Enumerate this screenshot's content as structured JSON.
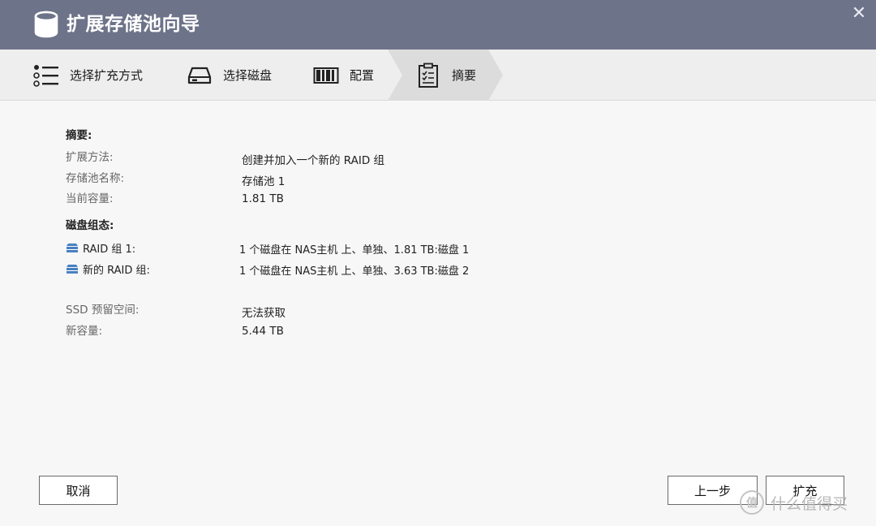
{
  "window": {
    "title": "扩展存储池向导",
    "close_symbol": "✕"
  },
  "steps": [
    {
      "label": "选择扩充方式",
      "icon": "list-icon",
      "active": false
    },
    {
      "label": "选择磁盘",
      "icon": "disk-drive-icon",
      "active": false
    },
    {
      "label": "配置",
      "icon": "raid-config-icon",
      "active": false
    },
    {
      "label": "摘要",
      "icon": "clipboard-checklist-icon",
      "active": true
    }
  ],
  "summary": {
    "heading": "摘要:",
    "items": [
      {
        "label": "扩展方法:",
        "value": "创建并加入一个新的 RAID 组"
      },
      {
        "label": "存储池名称:",
        "value": "存储池 1"
      },
      {
        "label": "当前容量:",
        "value": "1.81 TB"
      }
    ]
  },
  "disk_config": {
    "heading": "磁盘组态:",
    "groups": [
      {
        "label": "RAID 组 1:",
        "value": "1 个磁盘在 NAS主机 上、单独、1.81 TB:磁盘 1"
      },
      {
        "label": "新的 RAID 组:",
        "value": "1 个磁盘在 NAS主机 上、单独、3.63 TB:磁盘 2"
      }
    ]
  },
  "extra": {
    "items": [
      {
        "label": "SSD 预留空间:",
        "value": "无法获取"
      },
      {
        "label": "新容量:",
        "value": "5.44 TB"
      }
    ]
  },
  "buttons": {
    "cancel": "取消",
    "back": "上一步",
    "expand": "扩充"
  },
  "watermark": {
    "badge": "值",
    "text": "什么值得买"
  },
  "colors": {
    "titlebar": "#6d7389",
    "stepbar": "#eeeeee",
    "active_step": "#dcdcdc",
    "disk_icon": "#4a7fc1"
  }
}
